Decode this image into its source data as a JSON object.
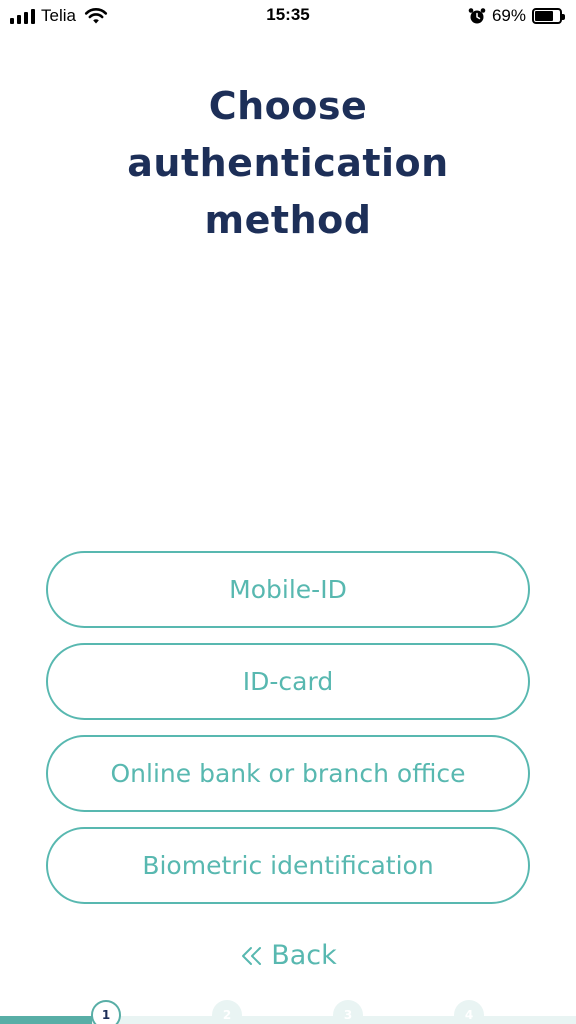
{
  "status_bar": {
    "carrier": "Telia",
    "time": "15:35",
    "battery_percent_label": "69%",
    "battery_level": 0.69,
    "icons": [
      "signal-icon",
      "wifi-icon",
      "alarm-icon",
      "battery-icon"
    ]
  },
  "title_lines": [
    "Choose",
    "authentication",
    "method"
  ],
  "options": [
    {
      "label": "Mobile-ID"
    },
    {
      "label": "ID-card"
    },
    {
      "label": "Online bank or branch office"
    },
    {
      "label": "Biometric identification"
    }
  ],
  "back": {
    "label": "Back",
    "icon": "double-chevron-left-icon"
  },
  "stepper": {
    "steps": [
      "1",
      "2",
      "3",
      "4"
    ],
    "current_step": 1,
    "progress": 0.16
  },
  "colors": {
    "title": "#1d2f58",
    "accent": "#58b8b0",
    "track": "#e9f4f3"
  }
}
